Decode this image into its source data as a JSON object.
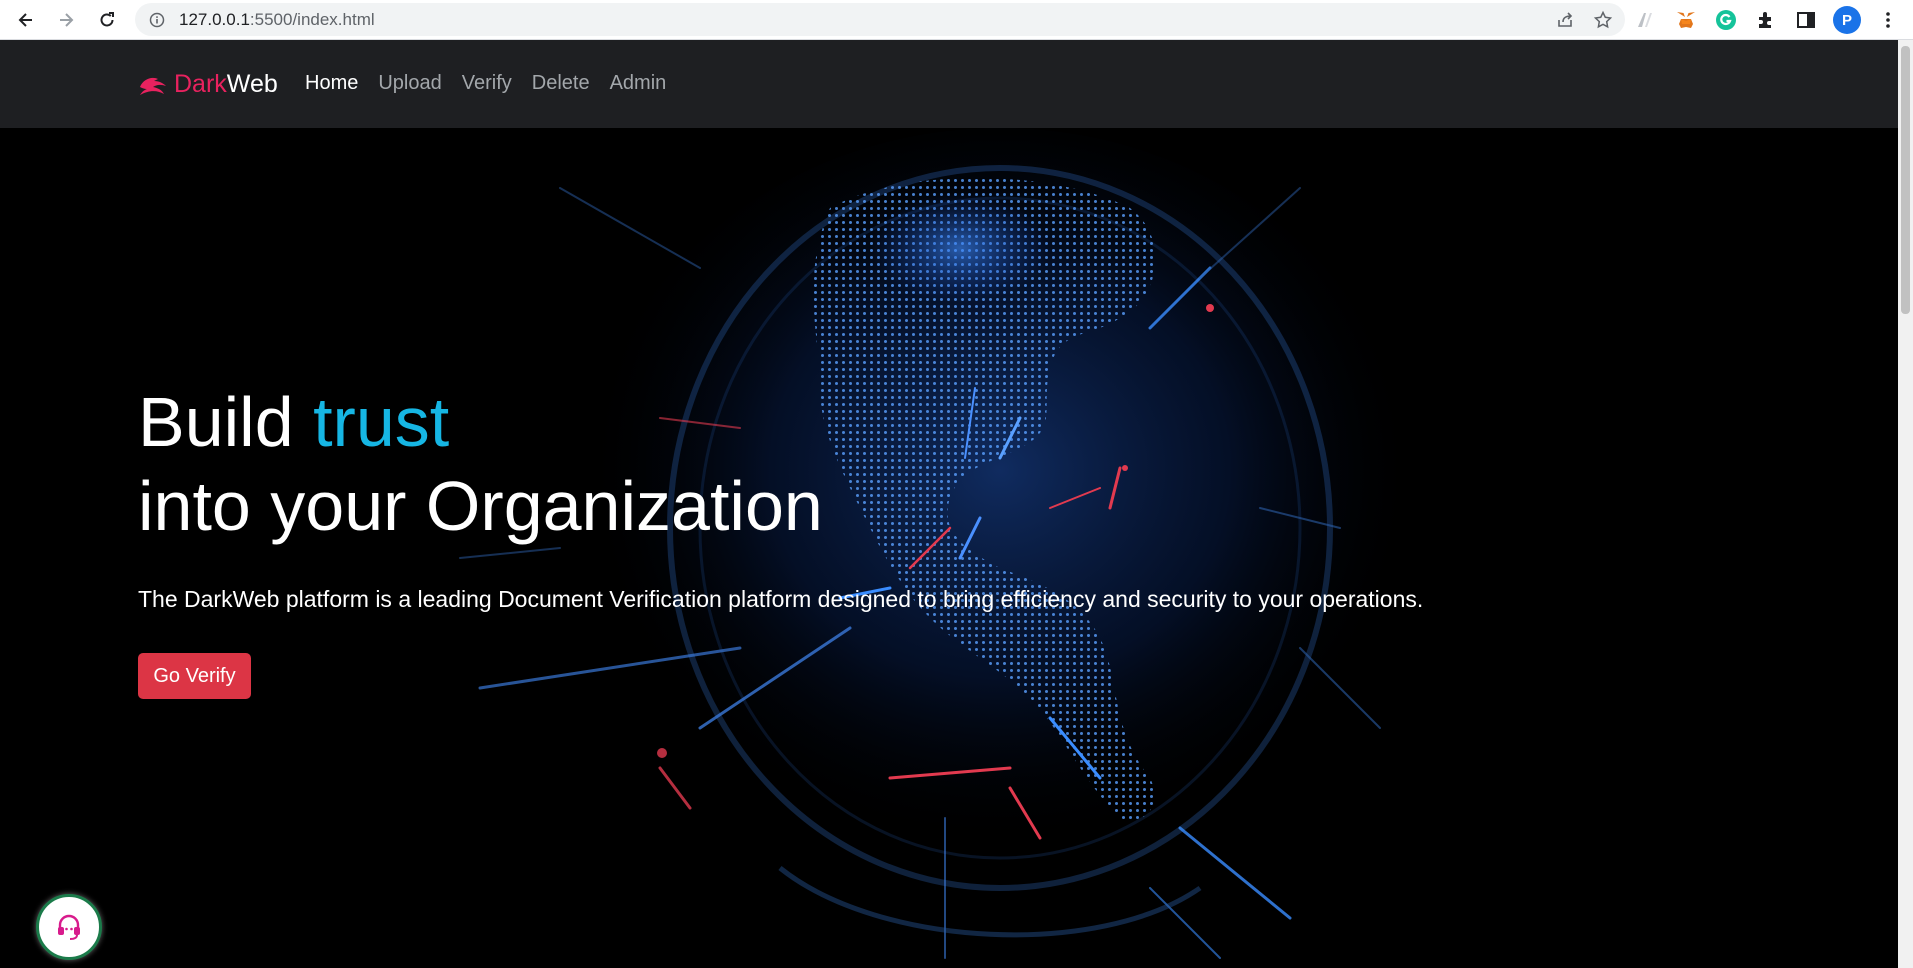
{
  "browser": {
    "url_host": "127.0.0.1",
    "url_rest": ":5500/index.html",
    "profile_initial": "P"
  },
  "nav": {
    "brand_part1": "Dark",
    "brand_part2": "Web",
    "links": [
      {
        "label": "Home",
        "active": true
      },
      {
        "label": "Upload",
        "active": false
      },
      {
        "label": "Verify",
        "active": false
      },
      {
        "label": "Delete",
        "active": false
      },
      {
        "label": "Admin",
        "active": false
      }
    ]
  },
  "hero": {
    "title_part1": "Build ",
    "title_accent": "trust",
    "title_line2": "into your Organization",
    "subtitle": "The DarkWeb platform is a leading Document Verification platform designed to bring efficiency and security to your operations.",
    "cta_label": "Go Verify"
  },
  "colors": {
    "brand_pink": "#e8225f",
    "accent_cyan": "#16b6e4",
    "cta_red": "#dc3545",
    "navbar_bg": "#1e1f22"
  },
  "icons": [
    "back-icon",
    "forward-icon",
    "reload-icon",
    "info-icon",
    "share-icon",
    "star-icon",
    "extensions-icon",
    "sidepanel-icon",
    "menu-icon",
    "headset-icon"
  ]
}
